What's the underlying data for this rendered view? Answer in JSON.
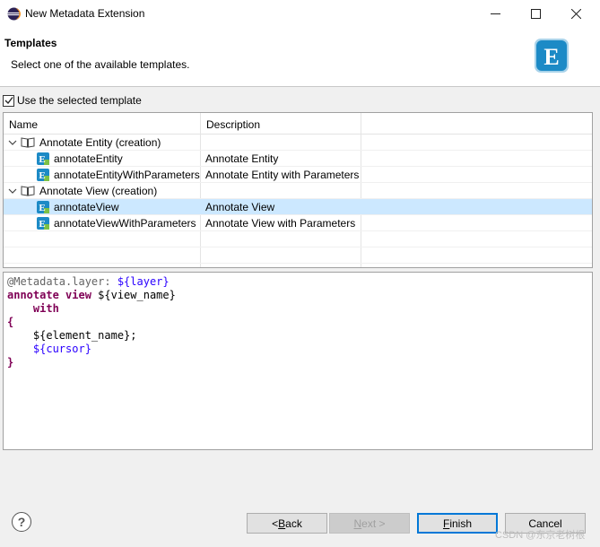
{
  "window": {
    "title": "New Metadata Extension"
  },
  "header": {
    "title": "Templates",
    "description": "Select one of the available templates.",
    "logo_letter": "E"
  },
  "use_template": {
    "label": "Use the selected template",
    "checked": true
  },
  "table": {
    "columns": [
      "Name",
      "Description"
    ],
    "groups": [
      {
        "label": "Annotate Entity (creation)",
        "items": [
          {
            "name": "annotateEntity",
            "description": "Annotate Entity"
          },
          {
            "name": "annotateEntityWithParameters",
            "description": "Annotate Entity with Parameters"
          }
        ]
      },
      {
        "label": "Annotate View (creation)",
        "items": [
          {
            "name": "annotateView",
            "description": "Annotate View"
          },
          {
            "name": "annotateViewWithParameters",
            "description": "Annotate View with Parameters"
          }
        ]
      }
    ],
    "template_icon_letter": "E"
  },
  "preview": {
    "l1_ann": "@Metadata.layer: ",
    "l1_var": "${layer}",
    "l2_kw": "annotate view ",
    "l2_var": "${view_name}",
    "l3_kw": "with",
    "l4": "{",
    "l5_var": "${element_name}",
    "l5_tail": ";",
    "l6_var": "${cursor}",
    "l7": "}"
  },
  "buttons": {
    "help": "?",
    "back_pre": "< ",
    "back_key": "B",
    "back_rest": "ack",
    "next_key": "N",
    "next_rest": "ext >",
    "finish_key": "F",
    "finish_rest": "inish",
    "cancel": "Cancel"
  },
  "watermark": "CSDN @东京老树根",
  "colors": {
    "selection": "#cce8ff",
    "keyword": "#7f0055",
    "annotation": "#646464",
    "variable": "#2a00ff",
    "logo": "#1c8ac6"
  }
}
